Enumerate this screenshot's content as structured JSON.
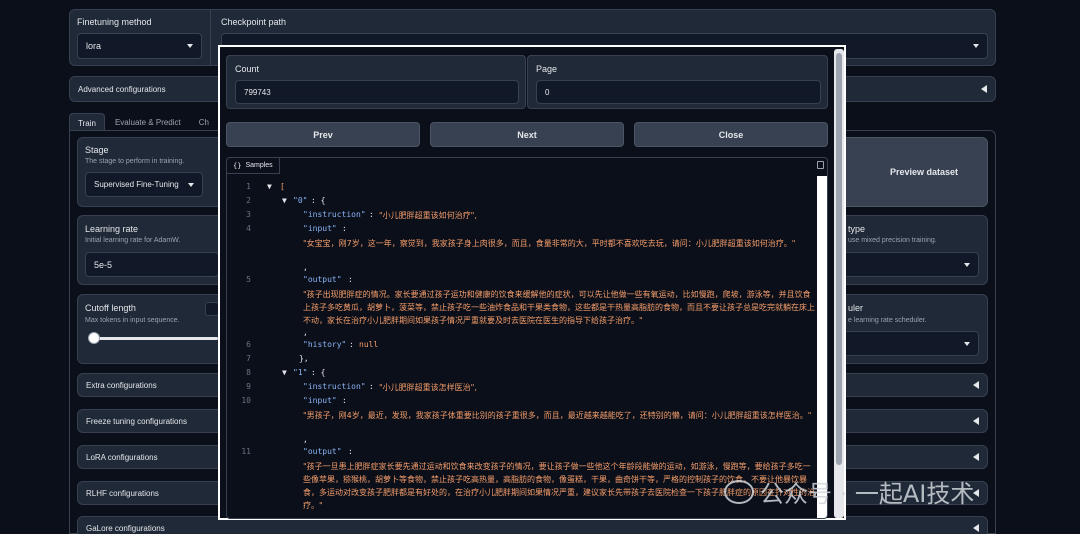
{
  "top": {
    "finetuning_method_label": "Finetuning method",
    "finetuning_method_value": "lora",
    "checkpoint_path_label": "Checkpoint path",
    "advanced_configurations": "Advanced configurations"
  },
  "tabs": [
    {
      "label": "Train"
    },
    {
      "label": "Evaluate & Predict"
    },
    {
      "label": "Ch"
    }
  ],
  "stage": {
    "label": "Stage",
    "sublabel": "The stage to perform in training.",
    "value": "Supervised Fine-Tuning"
  },
  "learning_rate": {
    "label": "Learning rate",
    "sublabel": "Initial learning rate for AdamW.",
    "value": "5e-5"
  },
  "cutoff": {
    "label": "Cutoff length",
    "sublabel": "Max tokens in input sequence.",
    "fill": 0.0
  },
  "right_panels": {
    "preview_dataset": "Preview dataset",
    "compute_type_label": "type",
    "compute_type_sub": "use mixed precision training.",
    "scheduler_label": "uler",
    "scheduler_sub": "e learning rate scheduler."
  },
  "accordions": [
    {
      "label": "Extra configurations"
    },
    {
      "label": "Freeze tuning configurations"
    },
    {
      "label": "LoRA configurations"
    },
    {
      "label": "RLHF configurations"
    },
    {
      "label": "GaLore configurations"
    }
  ],
  "modal": {
    "count_label": "Count",
    "count_value": "799743",
    "page_label": "Page",
    "page_value": "0",
    "prev": "Prev",
    "next": "Next",
    "close": "Close",
    "samples_label": "Samples"
  },
  "code": {
    "line_numbers": [
      "1",
      "2",
      "3",
      "4",
      "5",
      "6",
      "7",
      "8",
      "9",
      "10",
      "11"
    ],
    "l1": "[",
    "l2_key": "\"0\"",
    "l2_rest": ": {",
    "l3_key": "\"instruction\"",
    "l3_val": "\"小儿肥胖超重该如何治疗\",",
    "l4_key": "\"input\"",
    "l4_text": "\"女宝宝，刚7岁，这一年，察觉到，我家孩子身上肉很多，而且，食量非常的大，平时都不喜欢吃去玩，请问：小儿肥胖超重该如何治疗。\"",
    "l5_key": "\"output\"",
    "l5_text": "\"孩子出现肥胖症的情况。家长要通过孩子运功和健康的饮食来缓解他的症状，可以先让他做一些有氧运动，比如慢跑，爬坡，游泳等，并且饮食上孩子多吃黄瓜，胡萝卜，菠菜等，禁止孩子吃一些油炸食品和干果类食物，这些都是干热量高脂肪的食物，而且不要让孩子总是吃完就躺在床上不动，家长在治疗小儿肥胖期间如果孩子情况严重就要及时去医院在医生的指导下给孩子治疗。\"",
    "l6_key": "\"history\"",
    "l6_val": "null",
    "l7": "},",
    "l8_key": "\"1\"",
    "l8_rest": ": {",
    "l9_key": "\"instruction\"",
    "l9_val": "\"小儿肥胖超重该怎样医治\",",
    "l10_key": "\"input\"",
    "l10_text": "\"男孩子，刚4岁，最近，发现，我家孩子体重要比别的孩子重很多，而且，最近越来越能吃了，还特别的懒，请问：小儿肥胖超重该怎样医治。\"",
    "l11_key": "\"output\"",
    "l11_text": "\"孩子一旦患上肥胖症家长要先通过运动和饮食来改变孩子的情况，要让孩子做一些他这个年龄段能做的运动，如游泳，慢跑等，要给孩子多吃一些像苹果，猕猴桃，胡萝卜等食物，禁止孩子吃高热量，高脂肪的食物，像蛋糕，干果，曲奇饼干等，严格的控制孩子的饮食，不要让他暴饮暴食，多运动对改变孩子肥胖都是有好处的，在治疗小儿肥胖期间如果情况严重，建议家长先带孩子去医院检查一下孩子肥胖症的原因在针对性的治疗。\""
  },
  "watermark": "公众号 · 一起AI技术"
}
